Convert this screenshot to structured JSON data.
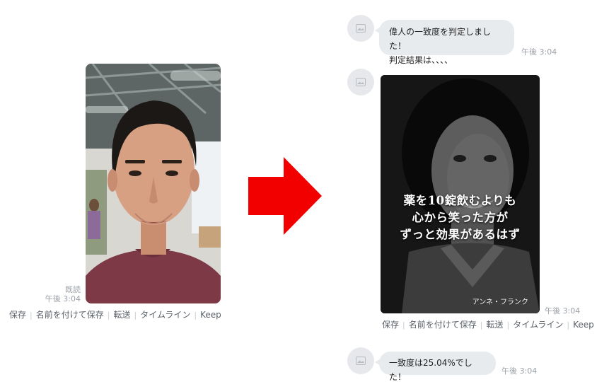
{
  "sent": {
    "read_status": "既読",
    "time": "午後 3:04",
    "actions": [
      "保存",
      "名前を付けて保存",
      "転送",
      "タイムライン",
      "Keep"
    ]
  },
  "received": {
    "message1": {
      "line1": "偉人の一致度を判定しました！",
      "line2": "判定結果は、、、、",
      "time": "午後 3:04"
    },
    "quote_image": {
      "quote_lines": [
        "薬を10錠飲むよりも",
        "心から笑った方が",
        "ずっと効果があるはず"
      ],
      "author": "アンネ・フランク",
      "time": "午後 3:04",
      "actions": [
        "保存",
        "名前を付けて保存",
        "転送",
        "タイムライン",
        "Keep"
      ]
    },
    "message2": {
      "text": "一致度は25.04%でした！",
      "time": "午後 3:04"
    }
  },
  "colors": {
    "arrow": "#f20000",
    "bubble": "#e8ebee",
    "meta_text": "#9aa0a6"
  },
  "icons": {
    "avatar": "image-placeholder-icon",
    "arrow": "arrow-right-icon"
  }
}
